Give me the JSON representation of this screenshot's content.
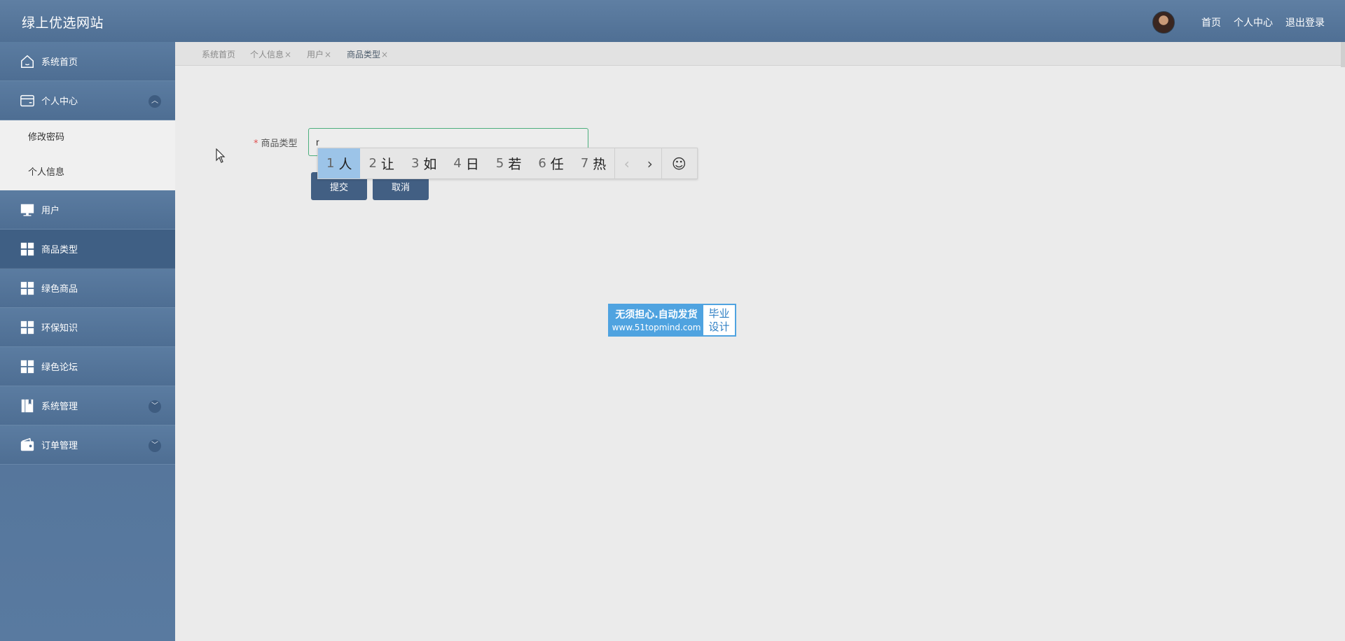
{
  "header": {
    "site_title": "绿上优选网站",
    "links": [
      "首页",
      "个人中心",
      "退出登录"
    ]
  },
  "sidebar": {
    "items": [
      {
        "label": "系统首页",
        "icon": "home-icon"
      },
      {
        "label": "个人中心",
        "icon": "wallet-icon",
        "expanded": true,
        "children": [
          "修改密码",
          "个人信息"
        ]
      },
      {
        "label": "用户",
        "icon": "monitor-icon"
      },
      {
        "label": "商品类型",
        "icon": "grid-icon",
        "active": true
      },
      {
        "label": "绿色商品",
        "icon": "grid-icon"
      },
      {
        "label": "环保知识",
        "icon": "grid-icon"
      },
      {
        "label": "绿色论坛",
        "icon": "grid-icon"
      },
      {
        "label": "系统管理",
        "icon": "book-icon",
        "collapsible": true
      },
      {
        "label": "订单管理",
        "icon": "purse-icon",
        "collapsible": true
      }
    ]
  },
  "tabs": [
    {
      "label": "系统首页",
      "closable": false
    },
    {
      "label": "个人信息",
      "closable": true
    },
    {
      "label": "用户",
      "closable": true
    },
    {
      "label": "商品类型",
      "closable": true,
      "current": true
    }
  ],
  "tab_close_glyph": "×",
  "form": {
    "label": "商品类型",
    "required_mark": "*",
    "input_value": "r",
    "submit_label": "提交",
    "cancel_label": "取消"
  },
  "ime": {
    "candidates": [
      {
        "num": "1",
        "text": "人"
      },
      {
        "num": "2",
        "text": "让"
      },
      {
        "num": "3",
        "text": "如"
      },
      {
        "num": "4",
        "text": "日"
      },
      {
        "num": "5",
        "text": "若"
      },
      {
        "num": "6",
        "text": "任"
      },
      {
        "num": "7",
        "text": "热"
      }
    ],
    "prev_glyph": "‹",
    "next_glyph": "›",
    "emoji_glyph": "☺"
  },
  "watermark": {
    "line1": "无须担心.自动发货",
    "line2": "www.51topmind.com",
    "right_line1": "毕业",
    "right_line2": "设计"
  },
  "colors": {
    "header": "#567699",
    "sidebar": "#4f6f94",
    "active_menu": "#3f5f84",
    "button": "#425f83",
    "input_border": "#4caf7d",
    "ime_selected": "#9cc4e8",
    "watermark": "#4fa3e0"
  }
}
